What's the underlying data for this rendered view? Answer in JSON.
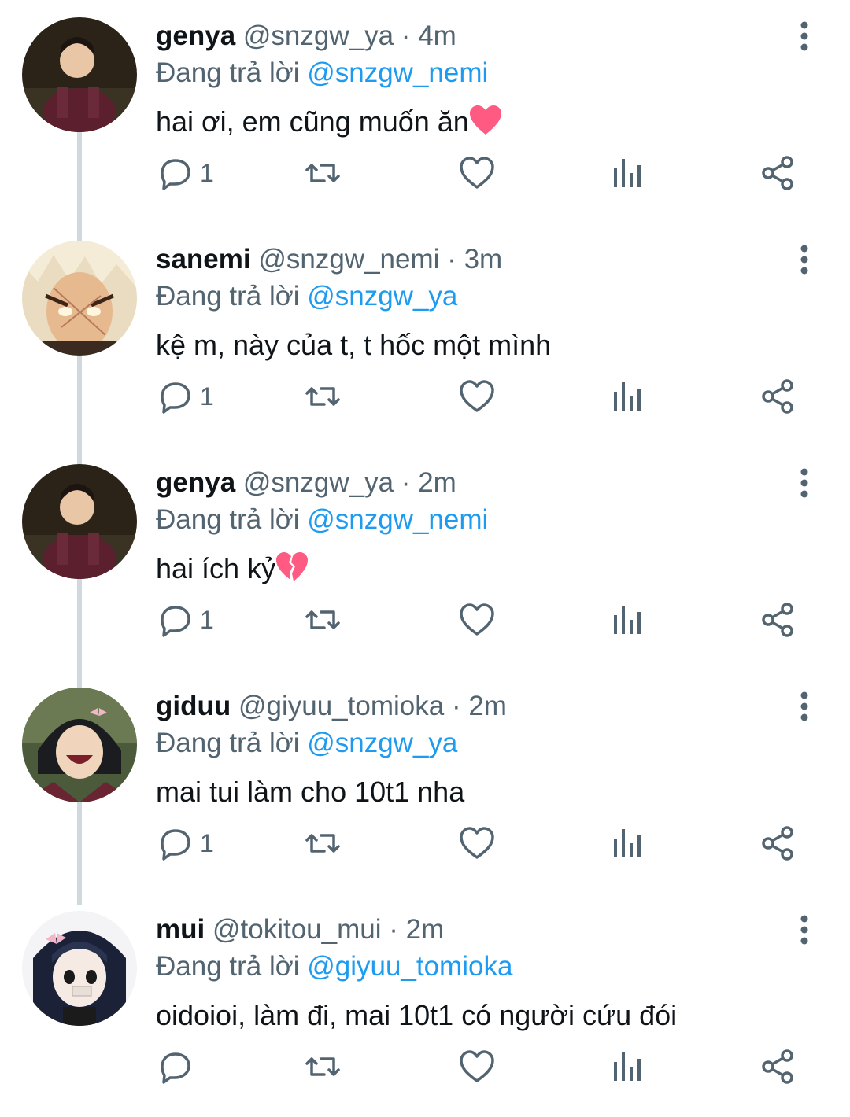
{
  "labels": {
    "replying_prefix": "Đang trả lời",
    "separator": "·"
  },
  "tweets": [
    {
      "name": "genya",
      "handle": "@snzgw_ya",
      "time": "4m",
      "replying_to": "@snzgw_nemi",
      "text": "hai ơi, em cũng muốn ăn",
      "emoji": "heart",
      "reply_count": "1",
      "avatar": "genya"
    },
    {
      "name": "sanemi",
      "handle": "@snzgw_nemi",
      "time": "3m",
      "replying_to": "@snzgw_ya",
      "text": "kệ m, này của t, t hốc một mình",
      "emoji": "",
      "reply_count": "1",
      "avatar": "sanemi"
    },
    {
      "name": "genya",
      "handle": "@snzgw_ya",
      "time": "2m",
      "replying_to": "@snzgw_nemi",
      "text": "hai ích kỷ",
      "emoji": "broken-heart",
      "reply_count": "1",
      "avatar": "genya"
    },
    {
      "name": "giduu",
      "handle": "@giyuu_tomioka",
      "time": "2m",
      "replying_to": "@snzgw_ya",
      "text": "mai tui làm cho 10t1 nha",
      "emoji": "",
      "reply_count": "1",
      "avatar": "giyuu"
    },
    {
      "name": "mui",
      "handle": "@tokitou_mui",
      "time": "2m",
      "replying_to": "@giyuu_tomioka",
      "text": "oidoioi, làm đi, mai 10t1 có người cứu đói",
      "emoji": "",
      "reply_count": "",
      "avatar": "muichiro"
    }
  ],
  "colors": {
    "text": "#0f1419",
    "secondary": "#536471",
    "link": "#1d9bf0",
    "thread_line": "#cfd9de",
    "heart_emoji": "#ff5a82"
  },
  "icons": {
    "reply": "reply-icon",
    "retweet": "retweet-icon",
    "like": "like-icon",
    "views": "views-icon",
    "share": "share-icon",
    "more": "more-icon"
  }
}
